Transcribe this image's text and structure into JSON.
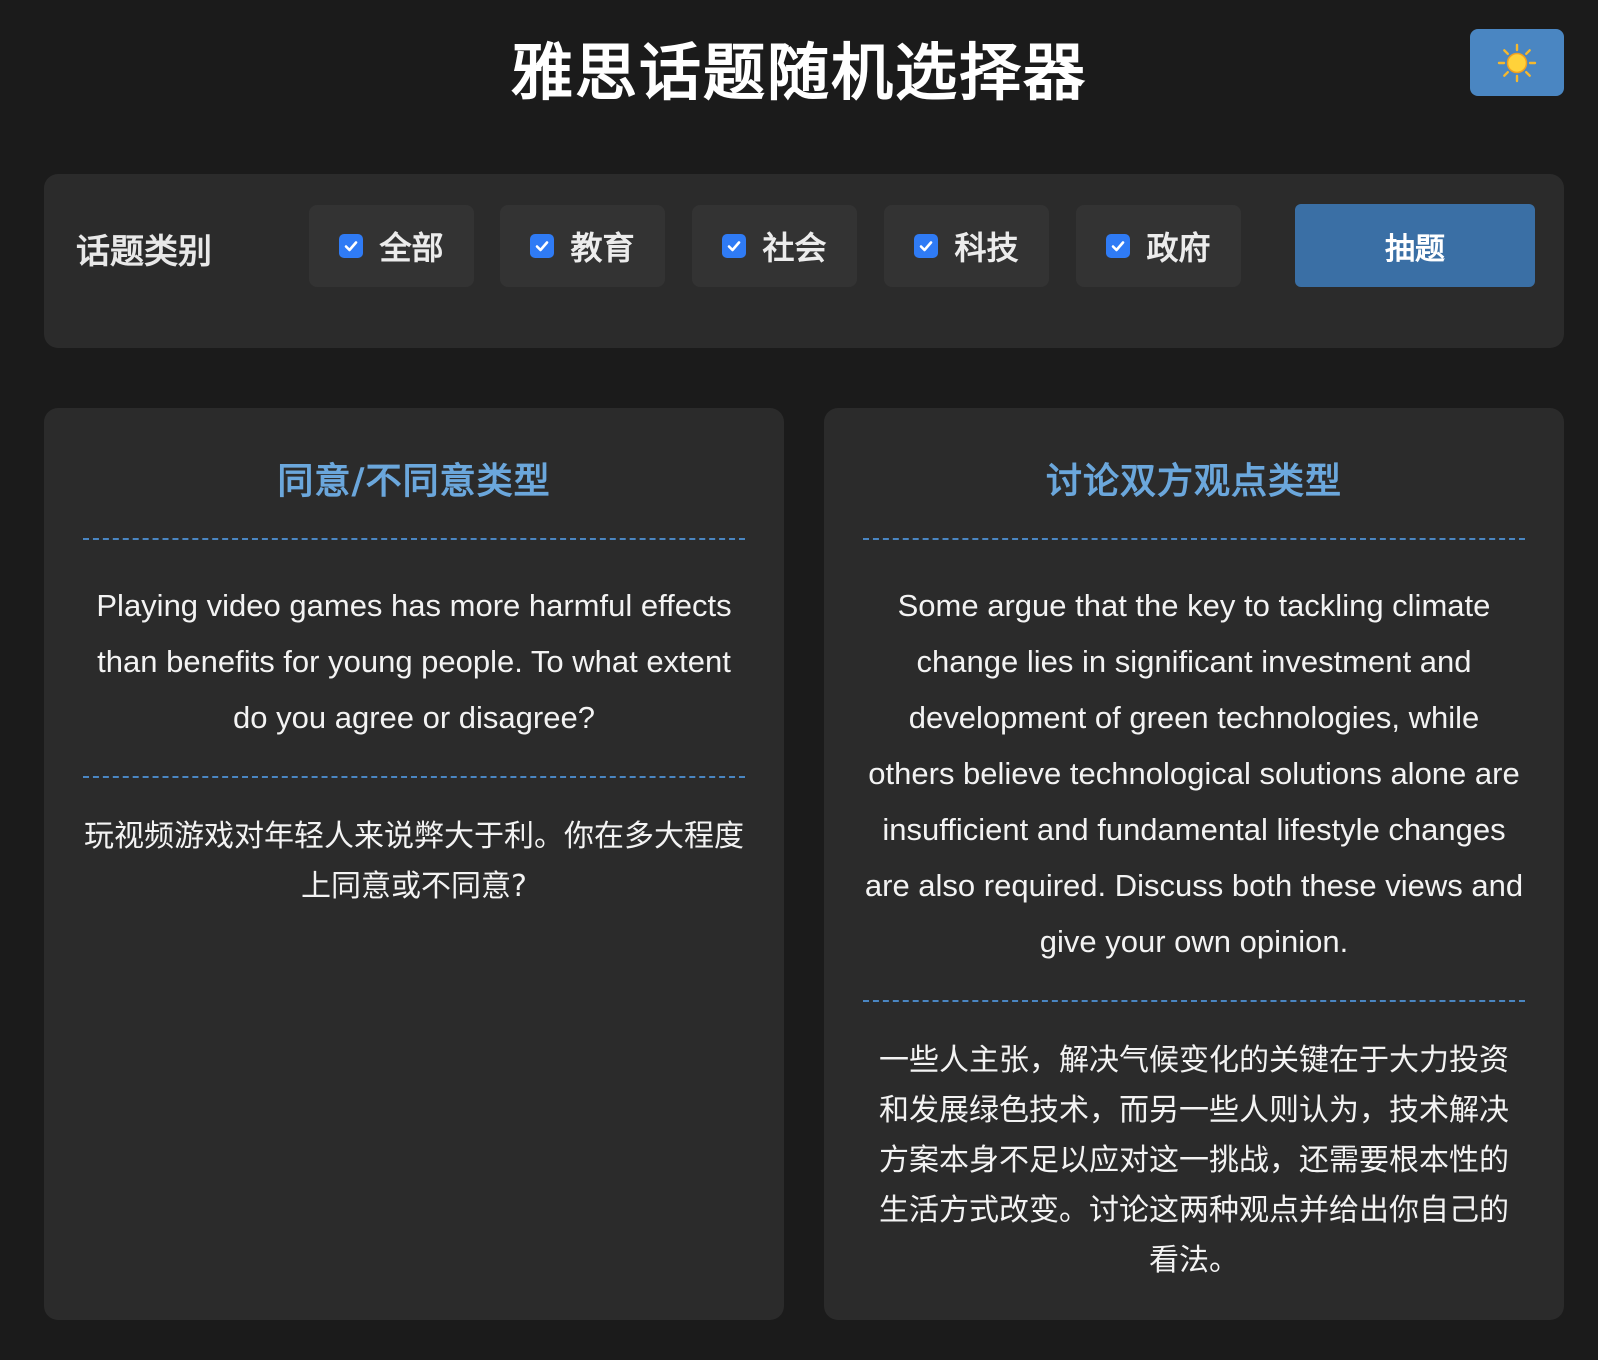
{
  "header": {
    "title": "雅思话题随机选择器",
    "theme_toggle_icon": "sun-icon"
  },
  "filter": {
    "label": "话题类别",
    "categories": [
      {
        "label": "全部",
        "checked": true
      },
      {
        "label": "教育",
        "checked": true
      },
      {
        "label": "社会",
        "checked": true
      },
      {
        "label": "科技",
        "checked": true
      },
      {
        "label": "政府",
        "checked": true
      }
    ],
    "draw_button": "抽题"
  },
  "cards": [
    {
      "title": "同意/不同意类型",
      "english": "Playing video games has more harmful effects than benefits for young people. To what extent do you agree or disagree?",
      "chinese": "玩视频游戏对年轻人来说弊大于利。你在多大程度上同意或不同意?"
    },
    {
      "title": "讨论双方观点类型",
      "english": "Some argue that the key to tackling climate change lies in significant investment and development of green technologies, while others believe technological solutions alone are insufficient and fundamental lifestyle changes are also required. Discuss both these views and give your own opinion.",
      "chinese": "一些人主张，解决气候变化的关键在于大力投资和发展绿色技术，而另一些人则认为，技术解决方案本身不足以应对这一挑战，还需要根本性的生活方式改变。讨论这两种观点并给出你自己的看法。"
    }
  ],
  "colors": {
    "background": "#1b1b1b",
    "panel": "#2b2b2b",
    "accent": "#4a86c2",
    "card_title": "#6ba7dc",
    "checkbox": "#2f7bf5"
  }
}
